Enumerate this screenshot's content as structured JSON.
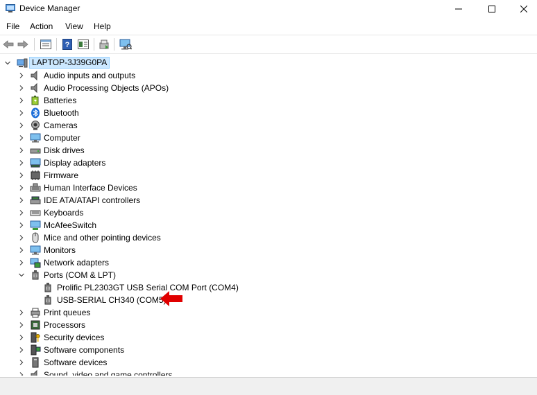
{
  "window": {
    "title": "Device Manager"
  },
  "menu": [
    "File",
    "Action",
    "View",
    "Help"
  ],
  "tree": {
    "root": "LAPTOP-3J39G0PA",
    "categories": [
      {
        "label": "Audio inputs and outputs",
        "icon": "speaker-icon"
      },
      {
        "label": "Audio Processing Objects (APOs)",
        "icon": "speaker-icon"
      },
      {
        "label": "Batteries",
        "icon": "battery-icon"
      },
      {
        "label": "Bluetooth",
        "icon": "bluetooth-icon"
      },
      {
        "label": "Cameras",
        "icon": "camera-icon"
      },
      {
        "label": "Computer",
        "icon": "computer-icon"
      },
      {
        "label": "Disk drives",
        "icon": "disk-drive-icon"
      },
      {
        "label": "Display adapters",
        "icon": "display-adapter-icon"
      },
      {
        "label": "Firmware",
        "icon": "firmware-icon"
      },
      {
        "label": "Human Interface Devices",
        "icon": "hid-icon"
      },
      {
        "label": "IDE ATA/ATAPI controllers",
        "icon": "ide-controller-icon"
      },
      {
        "label": "Keyboards",
        "icon": "keyboard-icon"
      },
      {
        "label": "McAfeeSwitch",
        "icon": "network-icon"
      },
      {
        "label": "Mice and other pointing devices",
        "icon": "mouse-icon"
      },
      {
        "label": "Monitors",
        "icon": "monitor-icon"
      },
      {
        "label": "Network adapters",
        "icon": "network-adapter-icon"
      },
      {
        "label": "Ports (COM & LPT)",
        "icon": "port-icon",
        "expanded": true,
        "children": [
          {
            "label": "Prolific PL2303GT USB Serial COM Port (COM4)",
            "icon": "port-icon"
          },
          {
            "label": "USB-SERIAL CH340 (COM5)",
            "icon": "port-icon"
          }
        ]
      },
      {
        "label": "Print queues",
        "icon": "printer-icon"
      },
      {
        "label": "Processors",
        "icon": "processor-icon"
      },
      {
        "label": "Security devices",
        "icon": "security-icon"
      },
      {
        "label": "Software components",
        "icon": "software-component-icon"
      },
      {
        "label": "Software devices",
        "icon": "software-device-icon"
      },
      {
        "label": "Sound, video and game controllers",
        "icon": "sound-icon"
      }
    ]
  },
  "colors": {
    "selection_bg": "#cce8ff",
    "selection_border": "#99d1ff",
    "annotation_arrow": "#e00000"
  }
}
